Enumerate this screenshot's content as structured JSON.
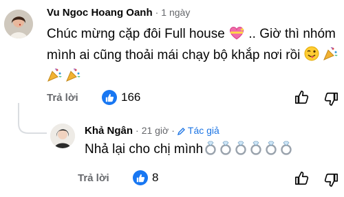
{
  "comments": [
    {
      "author": "Vu Ngoc Hoang Oanh",
      "time": "1 ngày",
      "line1": "Chúc mừng cặp đôi Full house",
      "line1_tail": ".. Giờ thì nhóm",
      "line2": "mình ai cũng thoải mái chạy bộ khắp nơi rồi",
      "reply_label": "Trả lời",
      "like_count": "166"
    },
    {
      "author": "Khả Ngân",
      "time": "21 giờ",
      "badge": "Tác giả",
      "text": "Nhả lại cho chị mình",
      "reply_label": "Trả lời",
      "like_count": "8"
    }
  ],
  "icons": {
    "like": "thumbs-up-icon",
    "dislike": "thumbs-down-icon",
    "reply": "reply-icon",
    "heart": "sparkling-heart-emoji",
    "wink": "winking-tongue-emoji",
    "party": "party-popper-emoji",
    "ring": "ring-emoji"
  },
  "colors": {
    "accent": "#1877f2",
    "muted": "#65676b",
    "text": "#050505"
  }
}
